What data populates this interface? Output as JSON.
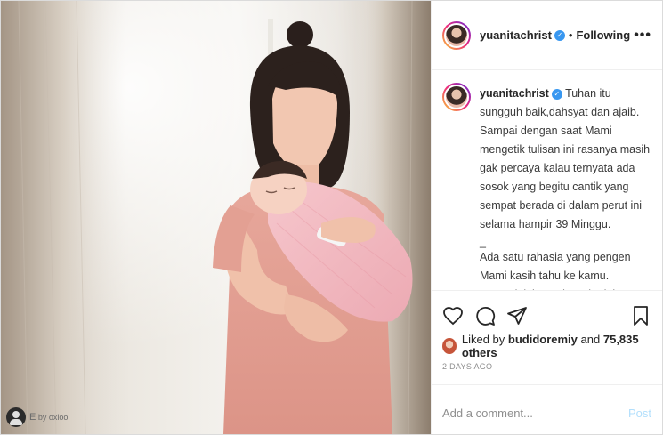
{
  "post": {
    "username": "yuanitachrist",
    "separator": "•",
    "follow_status": "Following",
    "more_label": "•••",
    "caption": {
      "username": "yuanitachrist",
      "paragraph1": "Tuhan itu sungguh baik,dahsyat dan ajaib. Sampai dengan saat Mami mengetik tulisan ini rasanya masih gak percaya kalau ternyata ada sosok yang begitu cantik yang sempat berada di dalam perut ini selama hampir 39 Minggu.",
      "separator": "_",
      "paragraph2": "Ada satu rahasia yang pengen Mami kasih tahu ke kamu. Semenjak kamu berada dalam perut,setiap hari Papi"
    },
    "likes": {
      "prefix": "Liked by",
      "user": "budidoremiy",
      "middle": "and",
      "count": "75,835 others"
    },
    "date": "2 DAYS AGO",
    "comment_placeholder": "Add a comment...",
    "post_label": "Post",
    "photo_credit": {
      "letter": "E",
      "text": "by oxioo"
    }
  },
  "icons": {
    "verified": "verified-badge-icon",
    "like": "heart-icon",
    "comment": "comment-bubble-icon",
    "share": "paper-plane-icon",
    "save": "bookmark-icon"
  },
  "colors": {
    "verified": "#3897f0",
    "post_button": "#b2dffc",
    "muted": "#8e8e8e"
  }
}
